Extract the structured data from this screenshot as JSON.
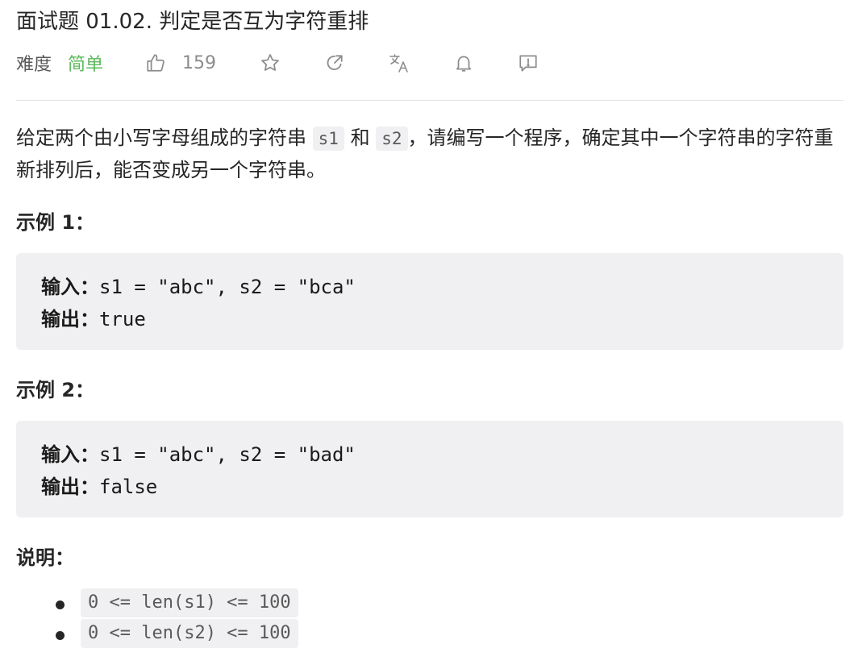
{
  "problem": {
    "title": "面试题 01.02. 判定是否互为字符重排",
    "difficulty_label": "难度",
    "difficulty_value": "简单",
    "likes": "159"
  },
  "actions": {
    "like_icon": "thumbs-up-icon",
    "star_icon": "star-icon",
    "share_icon": "share-icon",
    "translate_icon": "translate-icon",
    "bell_icon": "bell-icon",
    "feedback_icon": "feedback-icon"
  },
  "description": {
    "part1": "给定两个由小写字母组成的字符串 ",
    "code1": "s1",
    "part2": " 和 ",
    "code2": "s2",
    "part3": "，请编写一个程序，确定其中一个字符串的字符重新排列后，能否变成另一个字符串。"
  },
  "examples": [
    {
      "heading": "示例 1：",
      "input_label": "输入：",
      "input_value": "s1 = \"abc\", s2 = \"bca\"",
      "output_label": "输出：",
      "output_value": "true"
    },
    {
      "heading": "示例 2：",
      "input_label": "输入：",
      "input_value": "s1 = \"abc\", s2 = \"bad\"",
      "output_label": "输出：",
      "output_value": "false"
    }
  ],
  "notes": {
    "heading": "说明：",
    "items": [
      "0 <= len(s1) <= 100",
      "0 <= len(s2) <= 100"
    ]
  },
  "colors": {
    "difficulty_easy": "#5cb85c",
    "code_bg": "#f0f0f2",
    "icon_gray": "#8c8c8c"
  }
}
